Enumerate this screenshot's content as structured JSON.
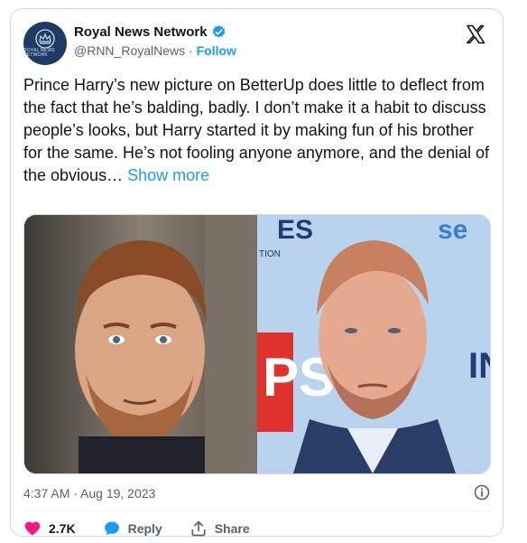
{
  "account": {
    "display_name": "Royal News Network",
    "handle": "@RNN_RoyalNews",
    "separator": "·",
    "follow_label": "Follow",
    "avatar_text": "ROYAL NEWS NETWORK",
    "verified_color": "#1d9bf0"
  },
  "tweet": {
    "text": "Prince Harry’s new picture on BetterUp does little to deflect from the fact that he’s balding, badly. I don’t make it a habit to discuss people’s looks, but Harry started it by making fun of his brother for the same. He’s not fooling anyone anymore, and the denial of the obvious…",
    "show_more_label": "Show more",
    "timestamp": "4:37 AM · Aug 19, 2023"
  },
  "media": {
    "backdrop_left_text": "",
    "backdrop_right_text": "ES se TION PS IN C"
  },
  "actions": {
    "likes": "2.7K",
    "reply_label": "Reply",
    "share_label": "Share"
  },
  "colors": {
    "accent": "#1d9bf0",
    "like": "#f91880",
    "text": "#0f1419",
    "muted": "#536471"
  },
  "icons": [
    "x-logo-icon",
    "verified-badge-icon",
    "crown-icon",
    "info-icon",
    "heart-icon",
    "reply-bubble-icon",
    "share-icon"
  ]
}
